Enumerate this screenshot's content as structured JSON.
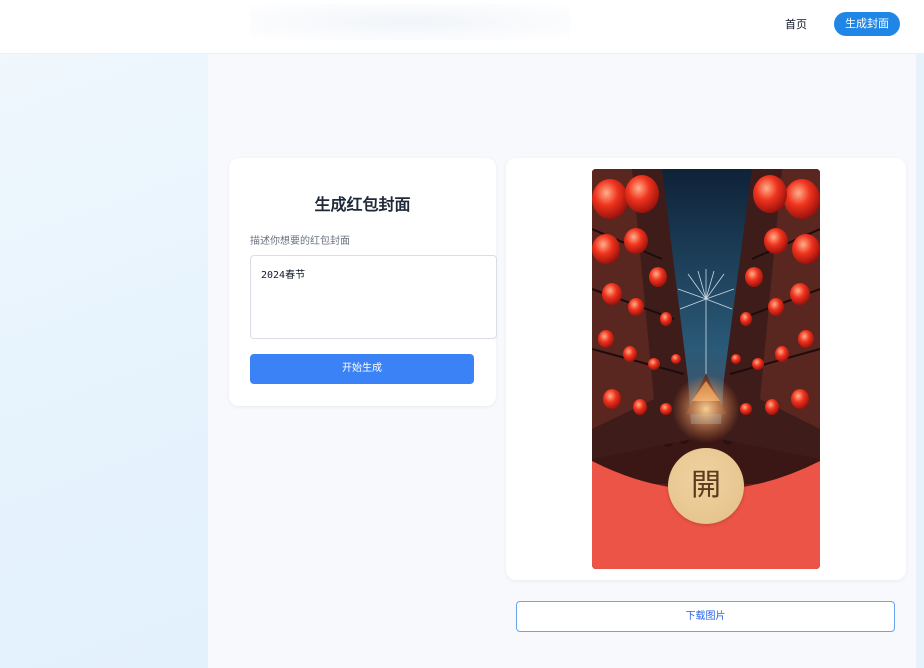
{
  "nav": {
    "home_label": "首页",
    "generate_label": "生成封面"
  },
  "form": {
    "title": "生成红包封面",
    "prompt_label": "描述你想要的红包封面",
    "prompt_value": "2024春节",
    "start_button": "开始生成"
  },
  "preview": {
    "seal_text": "開",
    "image_subject": "red-lanterns-street-fireworks"
  },
  "download": {
    "label": "下载图片"
  },
  "colors": {
    "primary": "#3b82f6",
    "nav_button": "#1f86e6",
    "envelope_red": "#eb5446",
    "seal_gold": "#e7c58f"
  }
}
